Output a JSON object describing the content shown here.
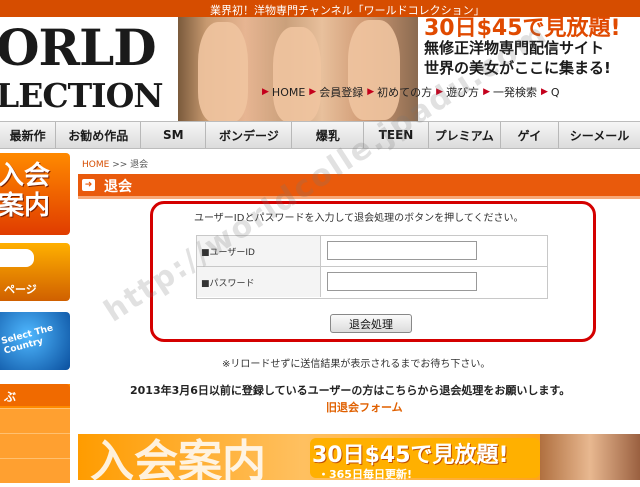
{
  "tagline": "業界初！洋物専門チャンネル「ワールドコレクション」",
  "logo": {
    "line1": "ORLD",
    "line2": "LECTION"
  },
  "promo": {
    "price": "30日$45で見放題!",
    "line2": "無修正洋物専門配信サイト",
    "line3": "世界の美女がここに集まる!"
  },
  "topnav": [
    {
      "label": "HOME"
    },
    {
      "label": "会員登録"
    },
    {
      "label": "初めての方"
    },
    {
      "label": "遊び方"
    },
    {
      "label": "一発検索"
    },
    {
      "label": "Q"
    }
  ],
  "categories": [
    {
      "label": "最新作"
    },
    {
      "label": "お勧め作品"
    },
    {
      "label": "SM"
    },
    {
      "label": "ボンデージ"
    },
    {
      "label": "爆乳"
    },
    {
      "label": "TEEN"
    },
    {
      "label": "プレミアム"
    },
    {
      "label": "ゲイ"
    },
    {
      "label": "シーメール"
    }
  ],
  "sidebar": {
    "join": "入会\n案内",
    "page": "ページ",
    "country": "Select The\nCountry",
    "menu_header": "ぶ"
  },
  "breadcrumb": {
    "home": "HOME",
    "sep": ">>",
    "current": "退会"
  },
  "page_title": "退会",
  "form": {
    "instruction": "ユーザーIDとパスワードを入力して退会処理のボタンを押してください。",
    "user_id_label": "■ユーザーID",
    "password_label": "■パスワード",
    "user_id_value": "",
    "password_value": "",
    "submit_label": "退会処理"
  },
  "note": "※リロードせずに送信結果が表示されるまでお待ち下さい。",
  "old_message": "2013年3月6日以前に登録しているユーザーの方はこちらから退会処理をお願いします。",
  "old_link": "旧退会フォーム",
  "banner": {
    "left": "入会案内",
    "price": "30日$45で見放題!",
    "sub": "・365日毎日更新!"
  },
  "watermark": "http://worldcolle.jpadu.com",
  "colors": {
    "accent": "#e95a0c",
    "highlight": "#d40000",
    "link": "#e06000"
  }
}
